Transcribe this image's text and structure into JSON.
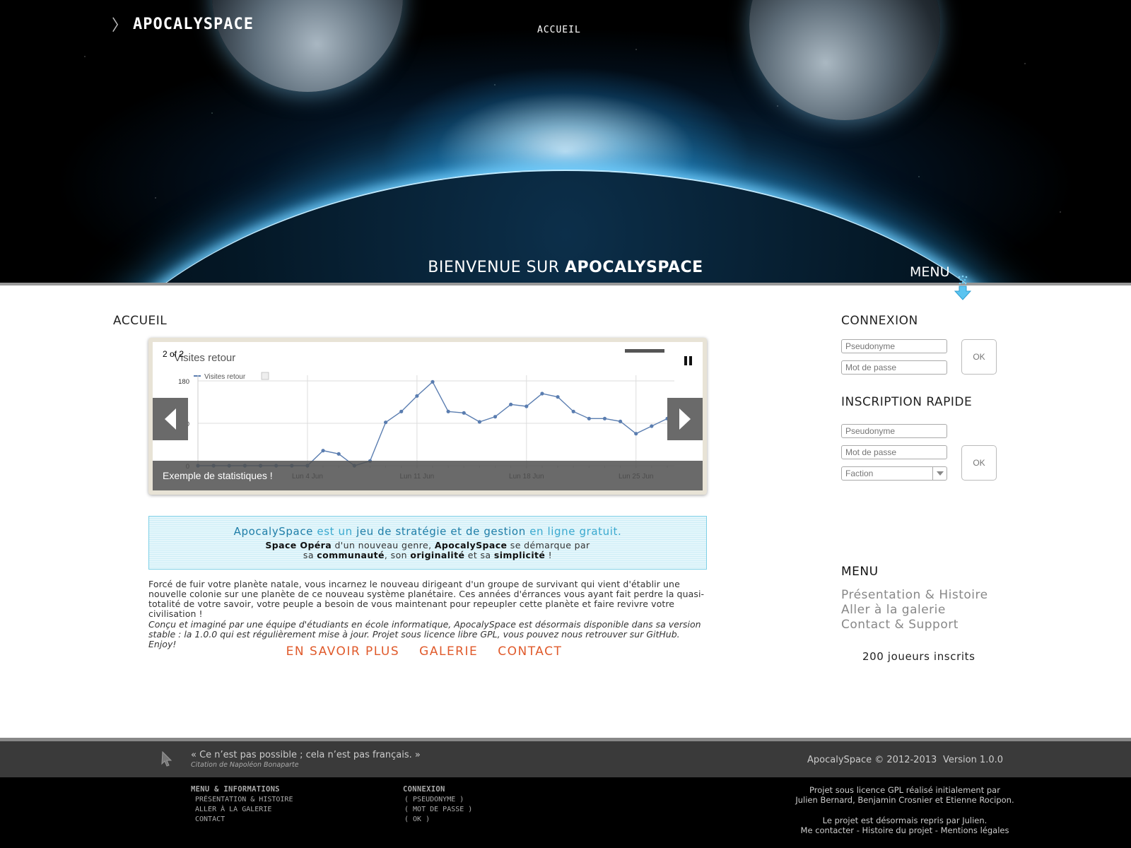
{
  "header": {
    "brand": "APOCALYSPACE",
    "brand_chevron": "〉",
    "nav_home": "ACCUEIL",
    "welcome_prefix": "BIENVENUE SUR",
    "welcome_brand": "APOCALYSPACE",
    "menu_label": "MENU"
  },
  "main": {
    "title": "ACCUEIL",
    "slider": {
      "counter": "2 of 2",
      "caption": "Exemple de statistiques !"
    },
    "pitch": {
      "brand": "ApocalySpace",
      "is": "est un",
      "genre": "jeu de stratégie et de gestion",
      "suffix": "en ligne gratuit.",
      "space_opera": "Space Opéra",
      "new_genre": "d'un nouveau genre,",
      "brand2": "ApocalySpace",
      "stands_out": "se démarque par",
      "its": "sa",
      "community": "communauté",
      "its2": ", son",
      "originality": "originalité",
      "and": "et sa",
      "simplicity": "simplicité",
      "bang": "!"
    },
    "intro": "Forcé de fuir votre planète natale, vous incarnez le nouveau dirigeant d'un groupe de survivant qui vient d'établir une nouvelle colonie sur une planète de ce nouveau système planétaire. Ces années d'érrances vous ayant fait perdre la quasi-totalité de votre savoir, votre peuple a besoin de vous maintenant pour repeupler cette planète et faire revivre votre civilisation !",
    "intro_italic": "Conçu et imaginé par une équipe d'étudiants en école informatique, ApocalySpace est désormais disponible dans sa version stable : la 1.0.0 qui est régulièrement mise à jour. Projet sous licence libre GPL, vous pouvez nous retrouver sur GitHub. Enjoy!",
    "cta": [
      "EN SAVOIR PLUS",
      "GALERIE",
      "CONTACT"
    ]
  },
  "chart_data": {
    "type": "line",
    "title": "Visites retour",
    "legend": "Visites retour",
    "series": [
      {
        "name": "Visites retour",
        "values": [
          0,
          0,
          0,
          0,
          0,
          0,
          0,
          0,
          32,
          25,
          0,
          10,
          92,
          115,
          148,
          178,
          115,
          112,
          93,
          104,
          130,
          126,
          153,
          146,
          115,
          100,
          100,
          94,
          68,
          84,
          100
        ]
      }
    ],
    "x_labels": [
      "Lun 4 Jun",
      "Lun 11 Jun",
      "Lun 18 Jun",
      "Lun 25 Jun"
    ],
    "y_ticks": [
      0,
      90,
      180
    ],
    "ylim": [
      0,
      180
    ],
    "grid": true,
    "line_color": "#5a7db0"
  },
  "sidebar": {
    "login_title": "CONNEXION",
    "login_user_placeholder": "Pseudonyme",
    "login_pass_placeholder": "Mot de passe",
    "login_ok": "OK",
    "signup_title": "INSCRIPTION RAPIDE",
    "signup_user_placeholder": "Pseudonyme",
    "signup_pass_placeholder": "Mot de passe",
    "signup_faction": "Faction",
    "signup_ok": "OK",
    "menu_title": "MENU",
    "menu_items": [
      "Présentation & Histoire",
      "Aller à la galerie",
      "Contact & Support"
    ],
    "players": "200 joueurs inscrits"
  },
  "footer": {
    "quote": "« Ce n’est pas possible ; cela n’est pas français. »",
    "quote_source": "Citation de Napoléon Bonaparte",
    "copyright": "ApocalySpace © 2012-2013",
    "version": "Version 1.0.0",
    "col1_title": "Menu & Informations",
    "col1_items": [
      "Présentation & Histoire",
      "Aller à la galerie",
      "Contact"
    ],
    "col2_title": "Connexion",
    "col2_items": [
      "( Pseudonyme )",
      "( Mot de passe )",
      "( OK )"
    ],
    "license_line1": "Projet sous licence GPL réalisé initialement par",
    "license_line2": "Julien Bernard, Benjamin Crosnier et Etienne Rocipon.",
    "takeover": "Le projet est désormais repris par Julien.",
    "links": [
      "Me contacter",
      "Histoire du projet",
      "Mentions légales"
    ],
    "link_sep": " - "
  },
  "colors": {
    "accent_cta": "#e05a2b",
    "pitch_blue": "#3aa9cf",
    "menu_arrow": "#5bc4f0"
  }
}
